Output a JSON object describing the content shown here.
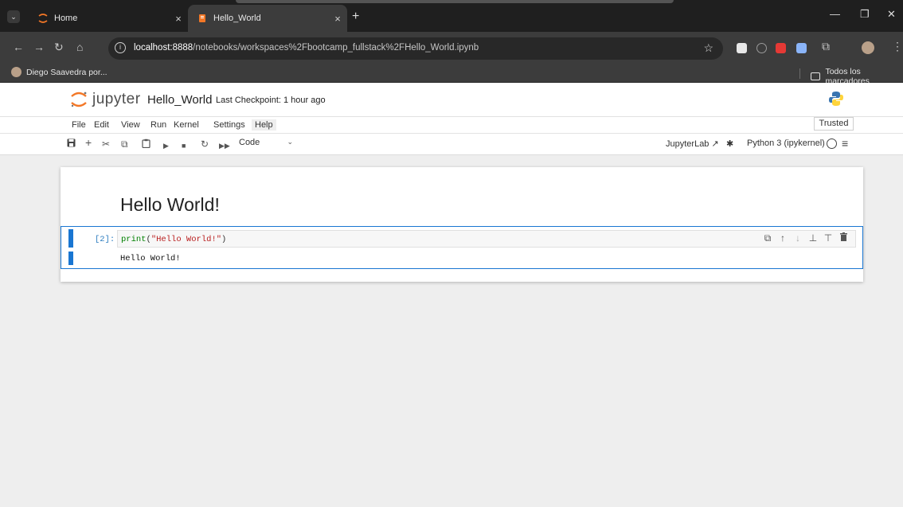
{
  "browser": {
    "tabs": [
      {
        "title": "Home",
        "active": false
      },
      {
        "title": "Hello_World",
        "active": true
      }
    ],
    "close_glyph": "×",
    "new_tab_glyph": "+",
    "address": {
      "host": "localhost:8888",
      "path": "/notebooks/workspaces%2Fbootcamp_fullstack%2FHello_World.ipynb"
    },
    "bookmarks": {
      "item": "Diego Saavedra por...",
      "all_bookmarks": "Todos los marcadores"
    }
  },
  "jupyter": {
    "wordmark": "jupyter",
    "notebook_title": "Hello_World",
    "checkpoint": "Last Checkpoint: 1 hour ago",
    "trusted": "Trusted",
    "menu": [
      "File",
      "Edit",
      "View",
      "Run",
      "Kernel",
      "Settings",
      "Help"
    ],
    "cell_type": "Code",
    "jupyterlab_link": "JupyterLab",
    "kernel_name": "Python 3 (ipykernel)"
  },
  "notebook": {
    "markdown_heading": "Hello World!",
    "code_cell": {
      "prompt": "[2]:",
      "code_fn": "print",
      "code_open": "(",
      "code_string": "\"Hello World!\"",
      "code_close": ")",
      "output": "Hello World!"
    }
  },
  "colors": {
    "accent_blue": "#1976d2",
    "jupyter_orange": "#f37726",
    "tab_bar_bg": "#1f1f1f",
    "toolbar_bg": "#3c3c3c"
  }
}
